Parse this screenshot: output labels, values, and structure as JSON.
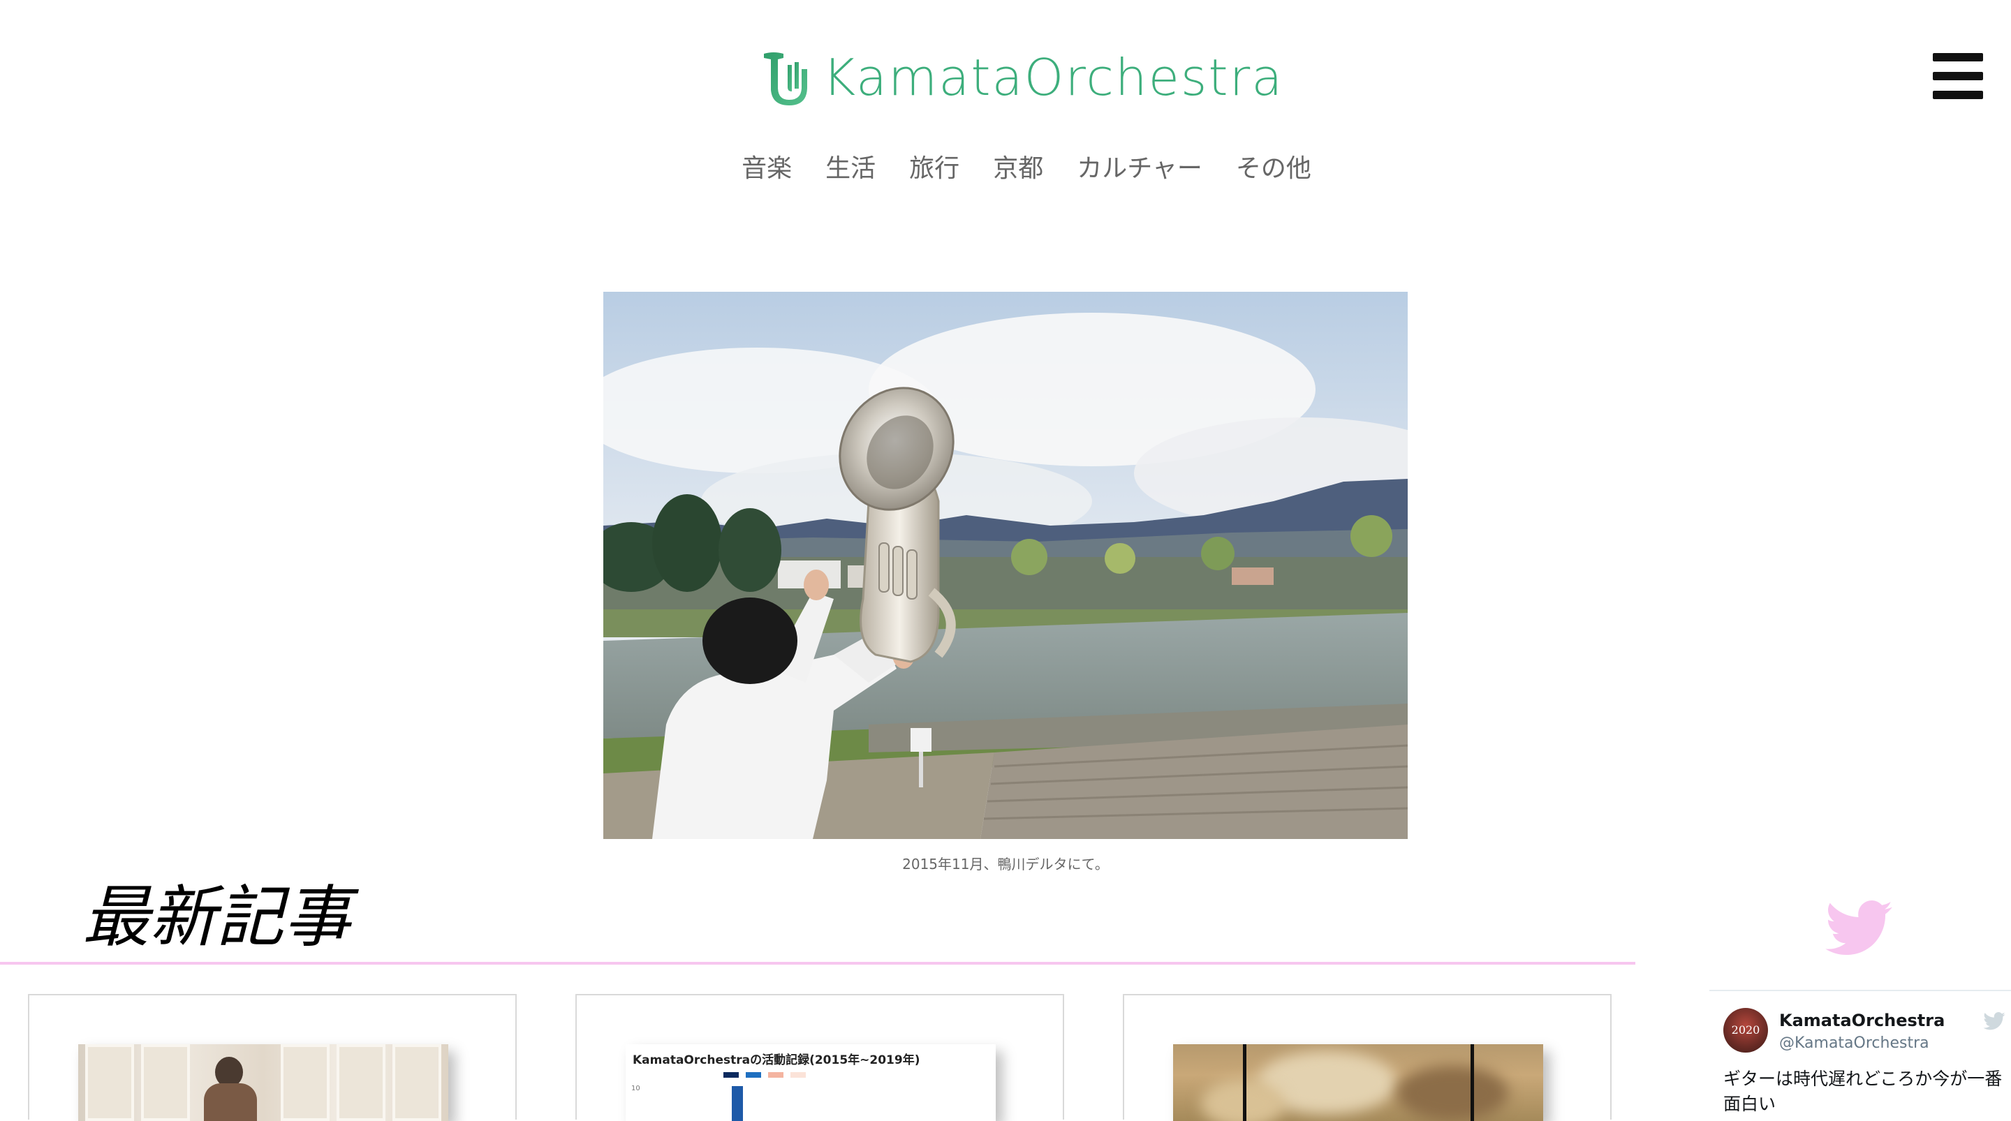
{
  "header": {
    "logo_text": "KamataOrchestra",
    "logo_color": "#3dae7c",
    "menu_icon": "hamburger-icon"
  },
  "nav": {
    "items": [
      {
        "label": "音楽"
      },
      {
        "label": "生活"
      },
      {
        "label": "旅行"
      },
      {
        "label": "京都"
      },
      {
        "label": "カルチャー"
      },
      {
        "label": "その他"
      }
    ]
  },
  "hero": {
    "caption": "2015年11月、鴨川デルタにて。"
  },
  "latest": {
    "title": "最新記事",
    "rule_color": "#f7c6ef",
    "cards": [
      {
        "thumb": "photo-person-guitar"
      },
      {
        "thumb": "chart",
        "chart_title": "KamataOrchestraの活動記録(2015年~2019年)",
        "y_tick": "10"
      },
      {
        "thumb": "photo-blurred"
      }
    ]
  },
  "twitter": {
    "bird_icon": "twitter-bird-icon",
    "bird_color": "#f7c6ef",
    "name": "KamataOrchestra",
    "handle": "@KamataOrchestra",
    "avatar_text": "2020",
    "tweet_text": "ギターは時代遅れどころか今が一番面白い"
  }
}
